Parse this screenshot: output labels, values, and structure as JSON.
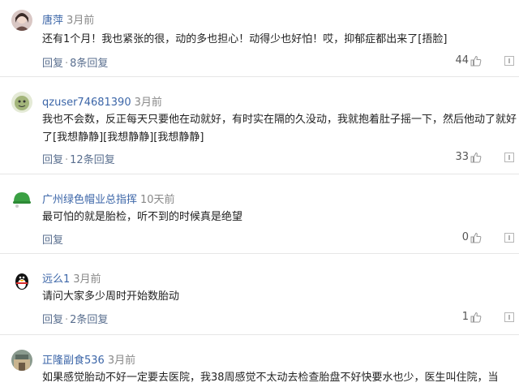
{
  "comments": [
    {
      "author": "唐萍",
      "time": "3月前",
      "text": "还有1个月！我也紧张的很，动的多也担心！动得少也好怕！哎，抑郁症都出来了[捂脸]",
      "reply_label": "回复",
      "sep": "·",
      "replies_label": "8条回复",
      "likes": "44",
      "avatar_icon": "woman-portrait-avatar"
    },
    {
      "author": "qzuser74681390",
      "time": "3月前",
      "text": "我也不会数，反正每天只要他在动就好，有时实在隔的久没动，我就抱着肚子摇一下，然后他动了就好了[我想静静][我想静静][我想静静]",
      "reply_label": "回复",
      "sep": "·",
      "replies_label": "12条回复",
      "likes": "33",
      "avatar_icon": "green-cartoon-avatar"
    },
    {
      "author": "广州绿色帽业总指挥",
      "time": "10天前",
      "text": "最可怕的就是胎检，听不到的时候真是绝望",
      "reply_label": "回复",
      "sep": "",
      "replies_label": "",
      "likes": "0",
      "avatar_icon": "green-hat-avatar"
    },
    {
      "author": "远么1",
      "time": "3月前",
      "text": "请问大家多少周时开始数胎动",
      "reply_label": "回复",
      "sep": "·",
      "replies_label": "2条回复",
      "likes": "1",
      "avatar_icon": "qq-penguin-avatar"
    },
    {
      "author": "正隆副食536",
      "time": "3月前",
      "text": "如果感觉胎动不好一定要去医院，我38周感觉不太动去检查胎盘不好快要水也少，医生叫住院，当",
      "reply_label": "",
      "sep": "",
      "replies_label": "",
      "likes": "",
      "avatar_icon": "store-photo-avatar"
    }
  ],
  "colors": {
    "author": "#3c66a8",
    "actions": "#5a6f8f",
    "divider": "#e6e6e6"
  }
}
